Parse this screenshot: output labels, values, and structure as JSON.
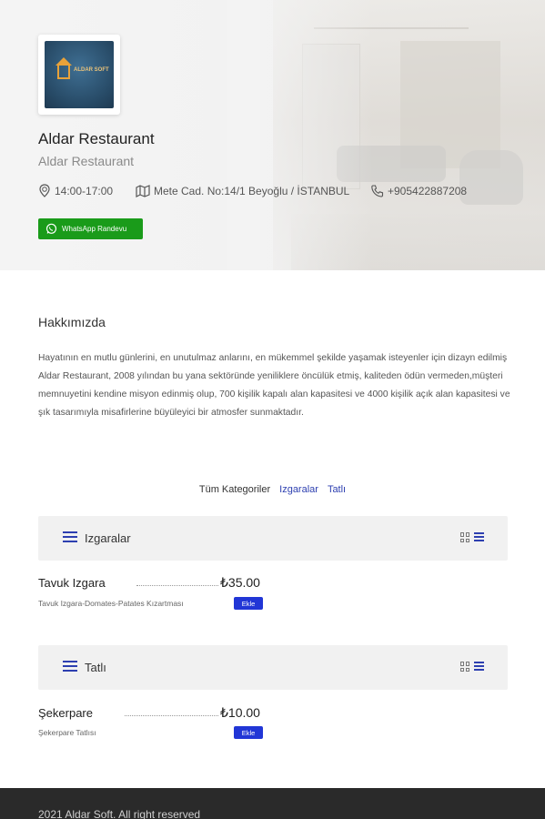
{
  "hero": {
    "title": "Aldar Restaurant",
    "subtitle": "Aldar Restaurant",
    "hours": "14:00-17:00",
    "address": "Mete Cad. No:14/1 Beyoğlu / İSTANBUL",
    "phone": "+905422887208",
    "whatsapp_label": "WhatsApp Randevu",
    "logo_text": "ALDAR SOFT",
    "colors": {
      "whatsapp": "#1a9b1a"
    }
  },
  "about": {
    "title": "Hakkımızda",
    "text": "Hayatının en mutlu günlerini, en unutulmaz anlarını, en mükemmel şekilde yaşamak isteyenler için dizayn edilmiş Aldar Restaurant, 2008 yılından bu yana sektöründe yeniliklere öncülük etmiş, kaliteden ödün vermeden,müşteri memnuyetini kendine misyon edinmiş olup, 700 kişilik kapalı alan kapasitesi ve 4000 kişilik açık alan kapasitesi ve şık tasarımıyla misafirlerine büyüleyici bir atmosfer sunmaktadır."
  },
  "categories": [
    "Tüm Kategoriler",
    "Izgaralar",
    "Tatlı"
  ],
  "sections": [
    {
      "title": "Izgaralar",
      "items": [
        {
          "name": "Tavuk Izgara",
          "price": "₺35.00",
          "description": "Tavuk Izgara-Domates-Patates Kızartması",
          "button": "Ekle"
        }
      ]
    },
    {
      "title": "Tatlı",
      "items": [
        {
          "name": "Şekerpare",
          "price": "₺10.00",
          "description": "Şekerpare Tatlısı",
          "button": "Ekle"
        }
      ]
    }
  ],
  "footer": {
    "text": "2021 Aldar Soft. All right reserved"
  },
  "colors": {
    "accent": "#2d3fb0",
    "button": "#2136d6",
    "footer_bg": "#2a2a2a"
  }
}
